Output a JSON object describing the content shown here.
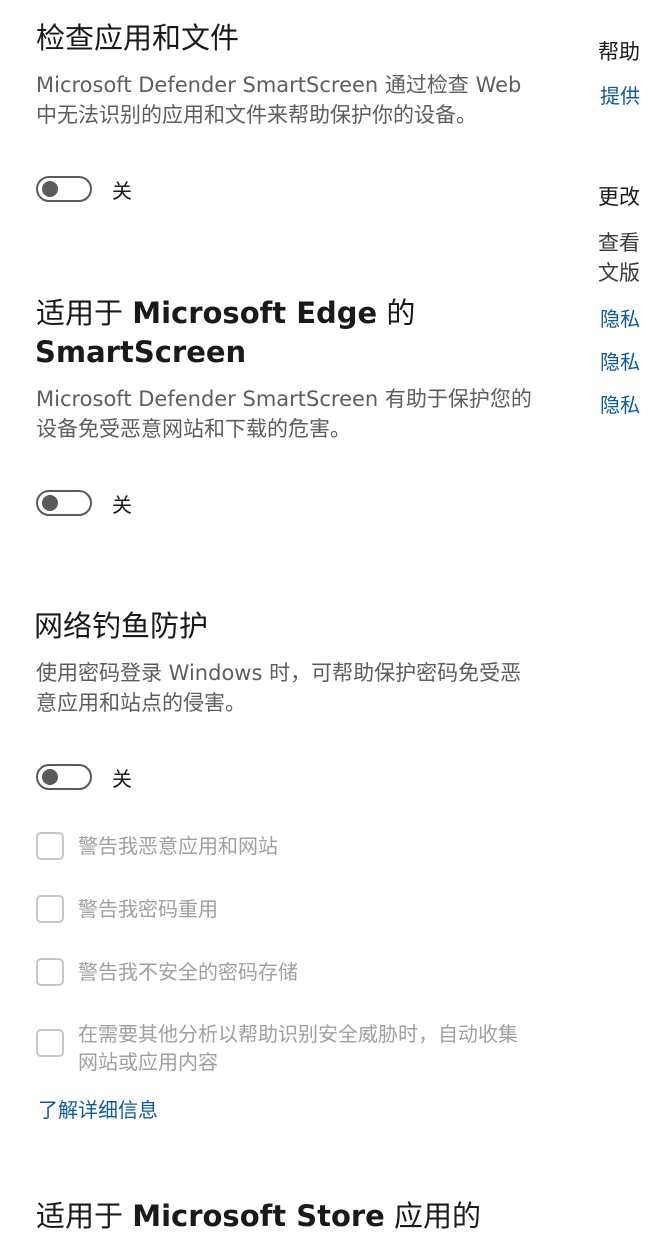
{
  "check_apps": {
    "title": "检查应用和文件",
    "description": "Microsoft Defender SmartScreen 通过检查 Web 中无法识别的应用和文件来帮助保护你的设备。",
    "toggle_state": "关"
  },
  "edge_smartscreen": {
    "title_prefix": "适用于 ",
    "title_bold1": "Microsoft Edge",
    "title_mid": " 的",
    "title_line2": "SmartScreen",
    "description": "Microsoft Defender SmartScreen 有助于保护您的设备免受恶意网站和下载的危害。",
    "toggle_state": "关"
  },
  "phishing": {
    "title": "网络钓鱼防护",
    "description": "使用密码登录 Windows 时，可帮助保护密码免受恶意应用和站点的侵害。",
    "toggle_state": "关",
    "options": [
      "警告我恶意应用和网站",
      "警告我密码重用",
      "警告我不安全的密码存储",
      "在需要其他分析以帮助识别安全威胁时，自动收集网站或应用内容"
    ],
    "learn_more": "了解详细信息"
  },
  "store_apps": {
    "title_prefix": "适用于 ",
    "title_bold": "Microsoft Store",
    "title_suffix": " 应用的"
  },
  "side_panel": {
    "help_title": "帮助",
    "help_link": "提供",
    "change_title": "更改",
    "change_text_1": "查看",
    "change_text_2": "文版",
    "privacy_links": [
      "隐私",
      "隐私",
      "隐私"
    ]
  }
}
